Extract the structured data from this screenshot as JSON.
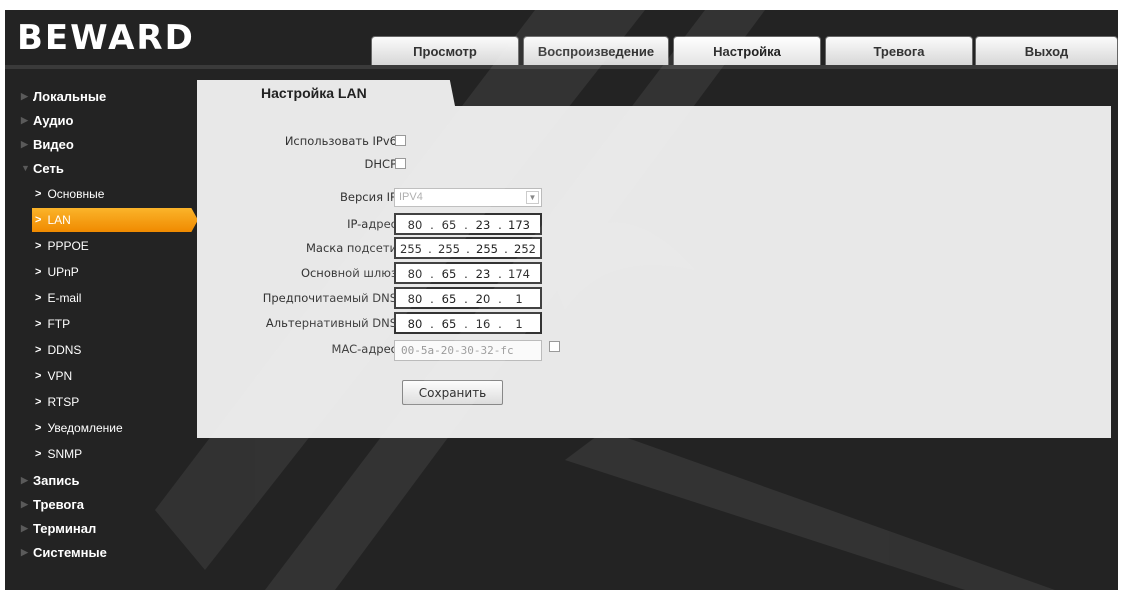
{
  "header": {
    "logo": "BEWARD",
    "tabs": [
      {
        "label": "Просмотр"
      },
      {
        "label": "Воспроизведение"
      },
      {
        "label": "Настройка"
      },
      {
        "label": "Тревога"
      },
      {
        "label": "Выход"
      }
    ],
    "active_tab": "Настройка"
  },
  "sidebar": {
    "items": [
      {
        "label": "Локальные",
        "level": "top"
      },
      {
        "label": "Аудио",
        "level": "top"
      },
      {
        "label": "Видео",
        "level": "top"
      },
      {
        "label": "Сеть",
        "level": "top",
        "expanded": true
      },
      {
        "label": "Основные",
        "level": "sub"
      },
      {
        "label": "LAN",
        "level": "sub",
        "active": true
      },
      {
        "label": "PPPOE",
        "level": "sub"
      },
      {
        "label": "UPnP",
        "level": "sub"
      },
      {
        "label": "E-mail",
        "level": "sub"
      },
      {
        "label": "FTP",
        "level": "sub"
      },
      {
        "label": "DDNS",
        "level": "sub"
      },
      {
        "label": "VPN",
        "level": "sub"
      },
      {
        "label": "RTSP",
        "level": "sub"
      },
      {
        "label": "Уведомление",
        "level": "sub"
      },
      {
        "label": "SNMP",
        "level": "sub"
      },
      {
        "label": "Запись",
        "level": "top"
      },
      {
        "label": "Тревога",
        "level": "top"
      },
      {
        "label": "Терминал",
        "level": "top"
      },
      {
        "label": "Системные",
        "level": "top"
      }
    ]
  },
  "main": {
    "section_title": "Настройка LAN",
    "form": {
      "ipv6_label": "Использовать IPv6",
      "ipv6_checked": false,
      "dhcp_label": "DHCP",
      "dhcp_checked": false,
      "ip_version_label": "Версия IP",
      "ip_version_value": "IPV4",
      "ip_label": "IP-адрес",
      "ip": [
        "80",
        "65",
        "23",
        "173"
      ],
      "mask_label": "Маска подсети",
      "mask": [
        "255",
        "255",
        "255",
        "252"
      ],
      "gateway_label": "Основной шлюз",
      "gateway": [
        "80",
        "65",
        "23",
        "174"
      ],
      "dns1_label": "Предпочитаемый DNS",
      "dns1": [
        "80",
        "65",
        "20",
        "1"
      ],
      "dns2_label": "Альтернативный DNS",
      "dns2": [
        "80",
        "65",
        "16",
        "1"
      ],
      "mac_label": "MAC-адрес",
      "mac": "00-5a-20-30-32-fc",
      "mac_checked": false,
      "save_label": "Сохранить"
    }
  },
  "colors": {
    "background": "#232323",
    "panel": "#e8e8e8",
    "active_item": "#f39200"
  }
}
